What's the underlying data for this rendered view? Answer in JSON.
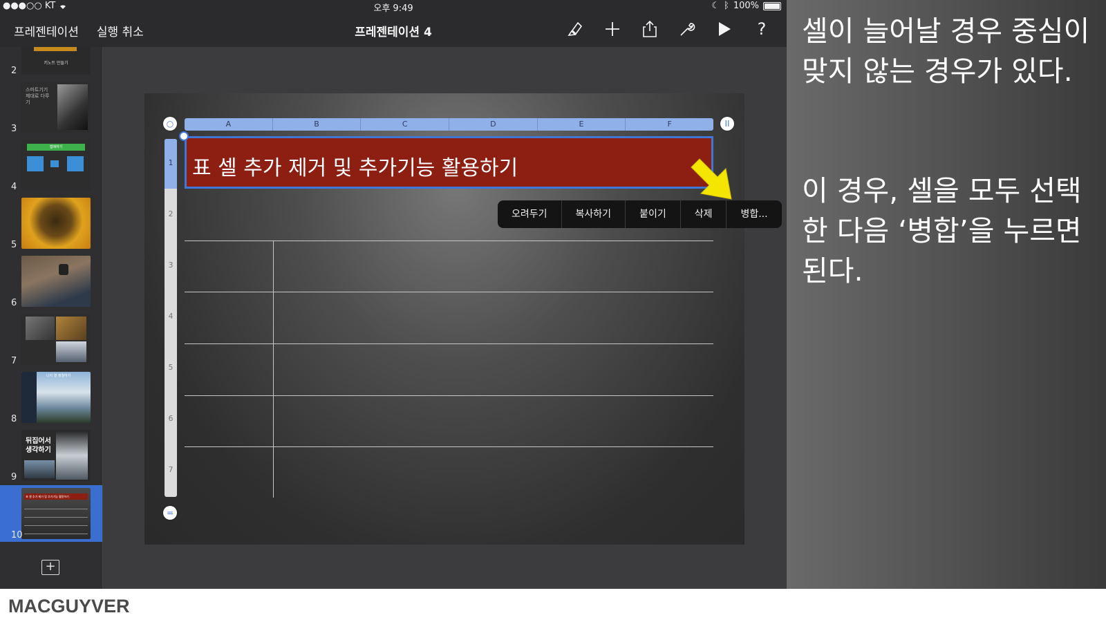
{
  "status_bar": {
    "carrier": "●●●○○ KT",
    "time": "오후 9:49",
    "battery": "100%"
  },
  "toolbar": {
    "back_label": "프레젠테이션",
    "undo_label": "실행 취소",
    "title": "프레젠테이션 4",
    "icons": [
      "format-brush-icon",
      "add-icon",
      "share-icon",
      "wrench-icon",
      "play-icon",
      "help-icon"
    ]
  },
  "sidebar": {
    "slides": [
      {
        "number": "2",
        "thumb_text": "키노트 만들기"
      },
      {
        "number": "3",
        "thumb_text": "스마트기기 제대로 다루기"
      },
      {
        "number": "4",
        "thumb_text": "앱매하기"
      },
      {
        "number": "5"
      },
      {
        "number": "6"
      },
      {
        "number": "7"
      },
      {
        "number": "8",
        "thumb_text": "나지 열 정렬하기"
      },
      {
        "number": "9",
        "thumb_text": "뒤집어서 생각하기"
      },
      {
        "number": "10",
        "thumb_text": "표 셀 추가 제거 및 추가기능 활용하기"
      }
    ],
    "add_slide_icon": "+"
  },
  "table": {
    "columns": [
      "A",
      "B",
      "C",
      "D",
      "E",
      "F"
    ],
    "rows": [
      "1",
      "2",
      "3",
      "4",
      "5",
      "6",
      "7"
    ],
    "title_cell": "표 셀 추가 제거 및 추가기능 활용하기",
    "top_left_knob": "○",
    "top_right_knob": "II",
    "bottom_knob": "="
  },
  "context_menu": [
    "오려두기",
    "복사하기",
    "붙이기",
    "삭제",
    "병합..."
  ],
  "caption": {
    "para1": "셀이 늘어날 경우 중심이 맞지 않는 경우가 있다.",
    "para2": "이 경우, 셀을 모두 선택한 다음 ‘병합’을 누르면 된다."
  },
  "footer": {
    "brand": "MACGUYVER"
  },
  "colors": {
    "accent": "#3f76d8",
    "title_cell": "#8c1e12",
    "arrow": "#f4e600"
  }
}
